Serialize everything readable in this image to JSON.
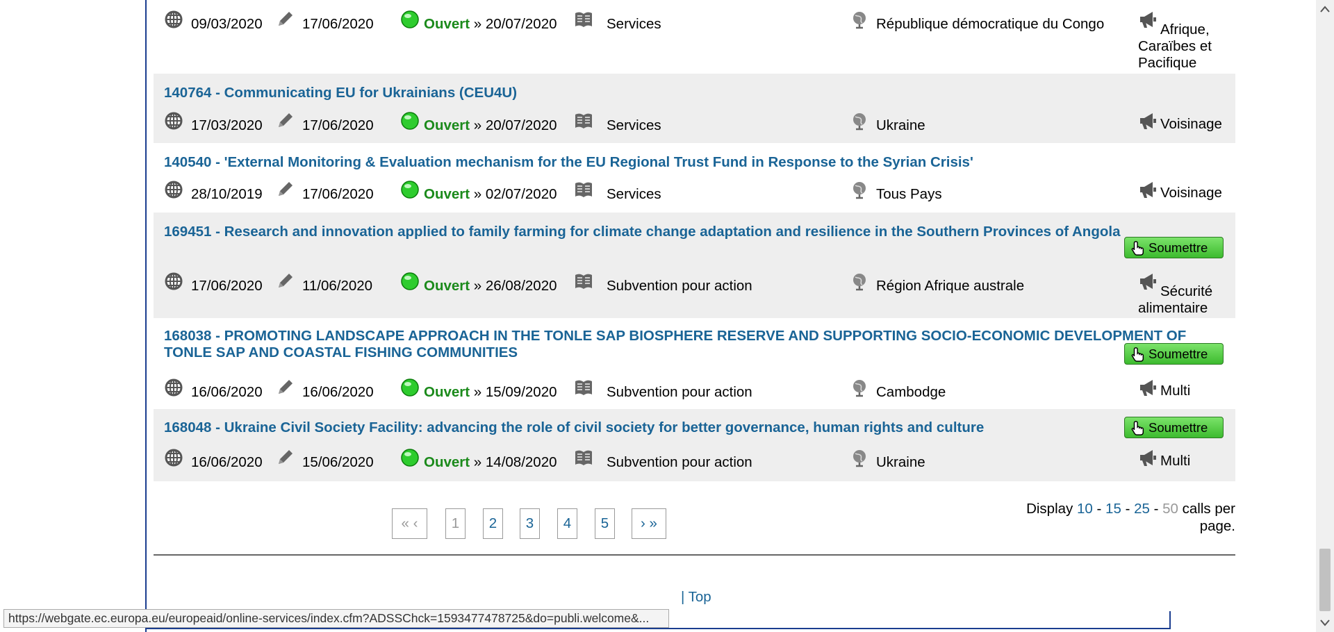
{
  "calls": [
    {
      "title": "",
      "publication_date": "09/03/2020",
      "modification_date": "17/06/2020",
      "status_label": "Ouvert",
      "deadline_sep": "»",
      "deadline": "20/07/2020",
      "type": "Services",
      "country": "République démocratique du Congo",
      "region": "Afrique, Caraïbes et Pacifique",
      "submit_label": ""
    },
    {
      "title": "140764 - Communicating EU for Ukrainians (CEU4U)",
      "publication_date": "17/03/2020",
      "modification_date": "17/06/2020",
      "status_label": "Ouvert",
      "deadline_sep": "»",
      "deadline": "20/07/2020",
      "type": "Services",
      "country": "Ukraine",
      "region": "Voisinage",
      "submit_label": ""
    },
    {
      "title": "140540 - 'External Monitoring & Evaluation mechanism for the EU Regional Trust Fund in Response to the Syrian Crisis'",
      "publication_date": "28/10/2019",
      "modification_date": "17/06/2020",
      "status_label": "Ouvert",
      "deadline_sep": "»",
      "deadline": "02/07/2020",
      "type": "Services",
      "country": "Tous Pays",
      "region": "Voisinage",
      "submit_label": ""
    },
    {
      "title": "169451 - Research and innovation applied to family farming for climate change adaptation and resilience in the Southern Provinces of Angola",
      "publication_date": "17/06/2020",
      "modification_date": "11/06/2020",
      "status_label": "Ouvert",
      "deadline_sep": "»",
      "deadline": "26/08/2020",
      "type": "Subvention pour action",
      "country": "Région Afrique australe",
      "region": "Sécurité alimentaire",
      "submit_label": "Soumettre"
    },
    {
      "title_line1": "168038 - PROMOTING LANDSCAPE APPROACH IN THE TONLE SAP BIOSPHERE RESERVE AND SUPPORTING SOCIO-ECONOMIC DEVELOPMENT OF",
      "title_line2": "TONLE SAP AND COASTAL FISHING COMMUNITIES",
      "publication_date": "16/06/2020",
      "modification_date": "16/06/2020",
      "status_label": "Ouvert",
      "deadline_sep": "»",
      "deadline": "15/09/2020",
      "type": "Subvention pour action",
      "country": "Cambodge",
      "region": "Multi",
      "submit_label": "Soumettre"
    },
    {
      "title": "168048 - Ukraine Civil Society Facility: advancing the role of civil society for better governance, human rights and culture",
      "publication_date": "16/06/2020",
      "modification_date": "15/06/2020",
      "status_label": "Ouvert",
      "deadline_sep": "»",
      "deadline": "14/08/2020",
      "type": "Subvention pour action",
      "country": "Ukraine",
      "region": "Multi",
      "submit_label": "Soumettre"
    }
  ],
  "pagination": {
    "first_prev": "« ‹",
    "pages": [
      "1",
      "2",
      "3",
      "4",
      "5"
    ],
    "current_page": "1",
    "next_last": "› »"
  },
  "display": {
    "prefix": "Display",
    "options": [
      "10",
      "15",
      "25",
      "50"
    ],
    "current": "50",
    "sep": "-",
    "suffix_line1": "calls per",
    "suffix_line2": "page."
  },
  "footer": {
    "separator": "|",
    "top_label": "Top"
  },
  "status_bar": {
    "url": "https://webgate.ec.europa.eu/europeaid/online-services/index.cfm?ADSSChck=1593477478725&do=publi.welcome&..."
  },
  "colors": {
    "link": "#1a6496",
    "status_open": "#1b8a1b",
    "row_shade": "#eeeeee",
    "button_green": "#3dbb2f",
    "frame_blue": "#1a3d8f"
  },
  "icons": {
    "publication": "globe-icon",
    "modification": "pencil-icon",
    "status": "green-dot-icon",
    "type": "book-icon",
    "country": "globe-stand-icon",
    "region": "megaphone-icon",
    "submit": "hand-pointer-icon"
  }
}
